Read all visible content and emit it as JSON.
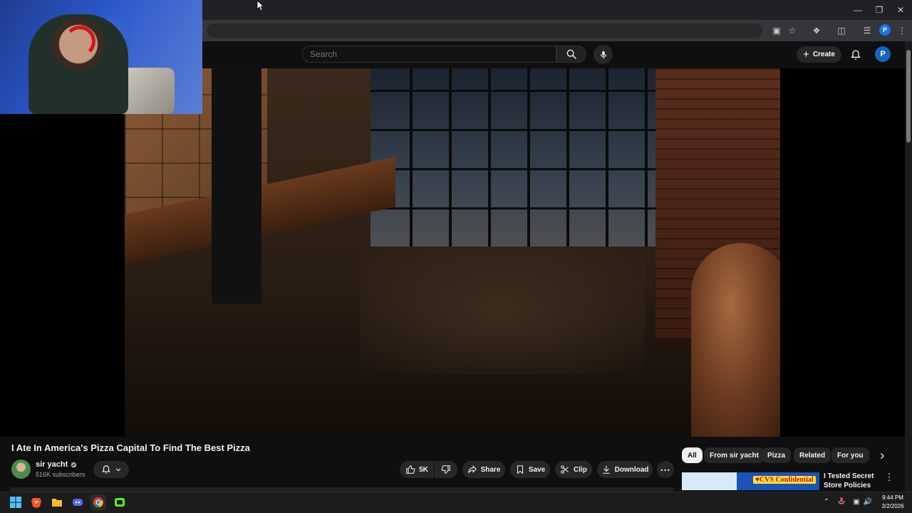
{
  "header": {
    "search_placeholder": "Search",
    "create_label": "Create",
    "avatar_letter": "P",
    "browser_profile_letter": "P"
  },
  "video": {
    "title": "I Ate In America's Pizza Capital To Find The Best Pizza",
    "channel": {
      "name": "sir yacht",
      "subscribers": "516K subscribers",
      "verified": true
    },
    "actions": {
      "like_count": "5K",
      "share_label": "Share",
      "save_label": "Save",
      "clip_label": "Clip",
      "download_label": "Download"
    }
  },
  "sidebar": {
    "chips": [
      {
        "label": "All",
        "active": true
      },
      {
        "label": "From sir yacht",
        "active": false
      },
      {
        "label": "Pizza",
        "active": false
      },
      {
        "label": "Related",
        "active": false
      },
      {
        "label": "For you",
        "active": false
      }
    ],
    "recommendation": {
      "title": "I Tested Secret Store Policies",
      "thumbnail_text": "CVS Confidential"
    }
  },
  "taskbar": {
    "time": "9:44 PM",
    "date": "3/2/2026",
    "apps": [
      "windows-start",
      "brave-browser",
      "file-explorer",
      "discord",
      "chrome",
      "streaming-app"
    ]
  },
  "colors": {
    "background": "#0f0f0f",
    "chip_active_bg": "#f1f1f1",
    "pill_bg": "#272727",
    "avatar_blue": "#1565c0"
  },
  "icons": {
    "search": "search-icon",
    "mic": "microphone-icon",
    "bell": "bell-icon",
    "like": "thumbs-up-icon",
    "dislike": "thumbs-down-icon",
    "share": "share-arrow-icon",
    "save": "bookmark-icon",
    "clip": "scissors-icon",
    "download": "download-icon",
    "more": "more-horizontal-icon"
  }
}
